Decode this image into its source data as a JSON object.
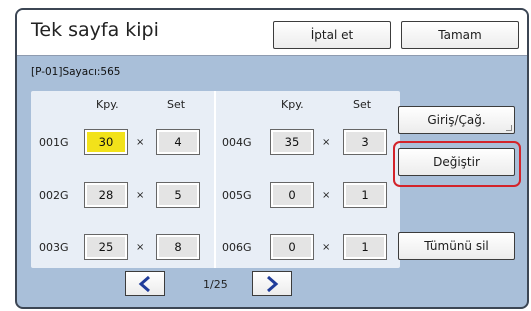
{
  "header": {
    "title": "Tek sayfa kipi",
    "cancel_label": "İptal et",
    "ok_label": "Tamam"
  },
  "counter_text": "[P-01]Sayacı:565",
  "columns": {
    "left": {
      "copies": "Kpy.",
      "set": "Set"
    },
    "right": {
      "copies": "Kpy.",
      "set": "Set"
    }
  },
  "groups": [
    {
      "id": "001G",
      "copies": "30",
      "sets": "4",
      "selected": true
    },
    {
      "id": "002G",
      "copies": "28",
      "sets": "5"
    },
    {
      "id": "003G",
      "copies": "25",
      "sets": "8"
    },
    {
      "id": "004G",
      "copies": "35",
      "sets": "3"
    },
    {
      "id": "005G",
      "copies": "0",
      "sets": "1"
    },
    {
      "id": "006G",
      "copies": "0",
      "sets": "1"
    }
  ],
  "multiply_sign": "×",
  "side_buttons": {
    "entry_recall": "Giriş/Çağ.",
    "change": "Değiştir",
    "delete_all": "Tümünü sil"
  },
  "pagination": {
    "indicator": "1/25"
  },
  "colors": {
    "background": "#a9bfd9",
    "selected_field": "#f2e21a",
    "nav_arrow": "#1f3c9a",
    "highlight_border": "#d3232a"
  }
}
